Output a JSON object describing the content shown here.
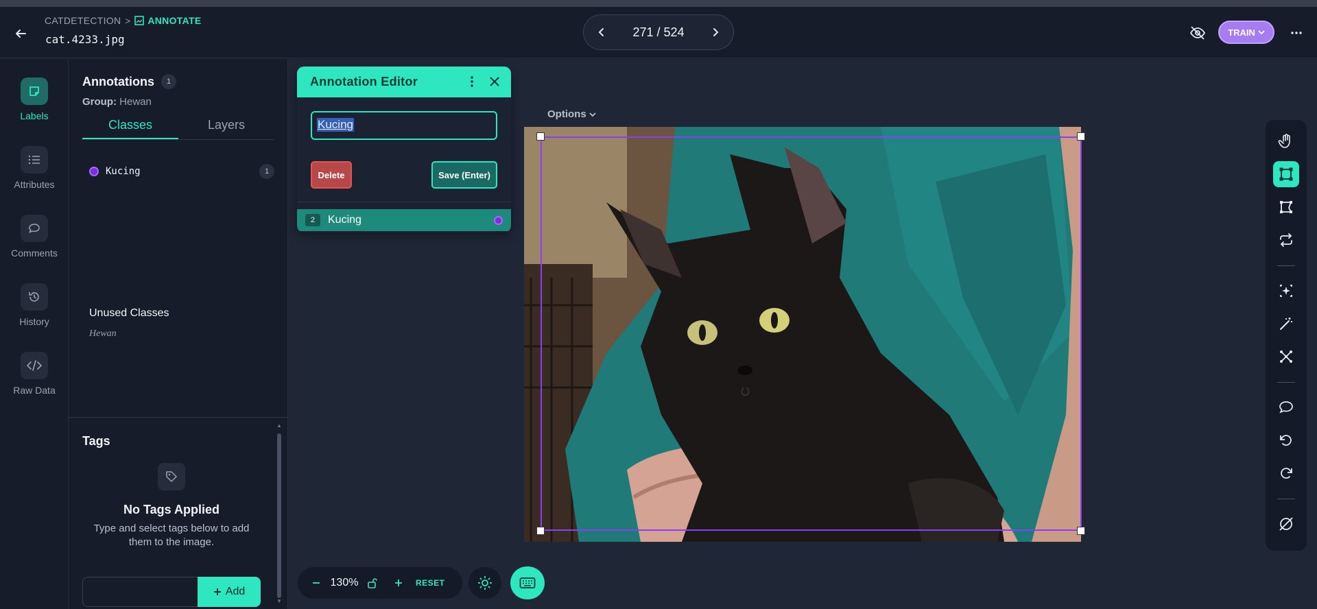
{
  "header": {
    "breadcrumb_project": "CATDETECTION",
    "breadcrumb_separator": ">",
    "breadcrumb_current": "ANNOTATE",
    "filename": "cat.4233.jpg",
    "pager_text": "271 / 524",
    "train_label": "TRAIN"
  },
  "rail": [
    {
      "label": "Labels",
      "icon": "label-icon"
    },
    {
      "label": "Attributes",
      "icon": "list-icon"
    },
    {
      "label": "Comments",
      "icon": "comment-icon"
    },
    {
      "label": "History",
      "icon": "history-icon"
    },
    {
      "label": "Raw Data",
      "icon": "code-icon"
    }
  ],
  "annotations": {
    "title": "Annotations",
    "count": "1",
    "group_label": "Group:",
    "group_value": "Hewan",
    "tabs": [
      "Classes",
      "Layers"
    ],
    "classes": [
      {
        "name": "Kucing",
        "count": "1",
        "color": "#7b2be0"
      }
    ],
    "unused_title": "Unused Classes",
    "unused_items": [
      "Hewan"
    ]
  },
  "tags": {
    "title": "Tags",
    "empty_title": "No Tags Applied",
    "empty_sub": "Type and select tags below to add them to the image.",
    "add_label": "Add"
  },
  "editor": {
    "title": "Annotation Editor",
    "input_value": "Kucing",
    "delete_label": "Delete",
    "save_label": "Save (Enter)",
    "row_num": "2",
    "row_label": "Kucing"
  },
  "canvas": {
    "options_label": "Options"
  },
  "zoom": {
    "value": "130%",
    "reset_label": "RESET"
  },
  "colors": {
    "accent": "#2ee6c0",
    "bbox": "#8a3ff5",
    "train": "#a77cf0"
  }
}
